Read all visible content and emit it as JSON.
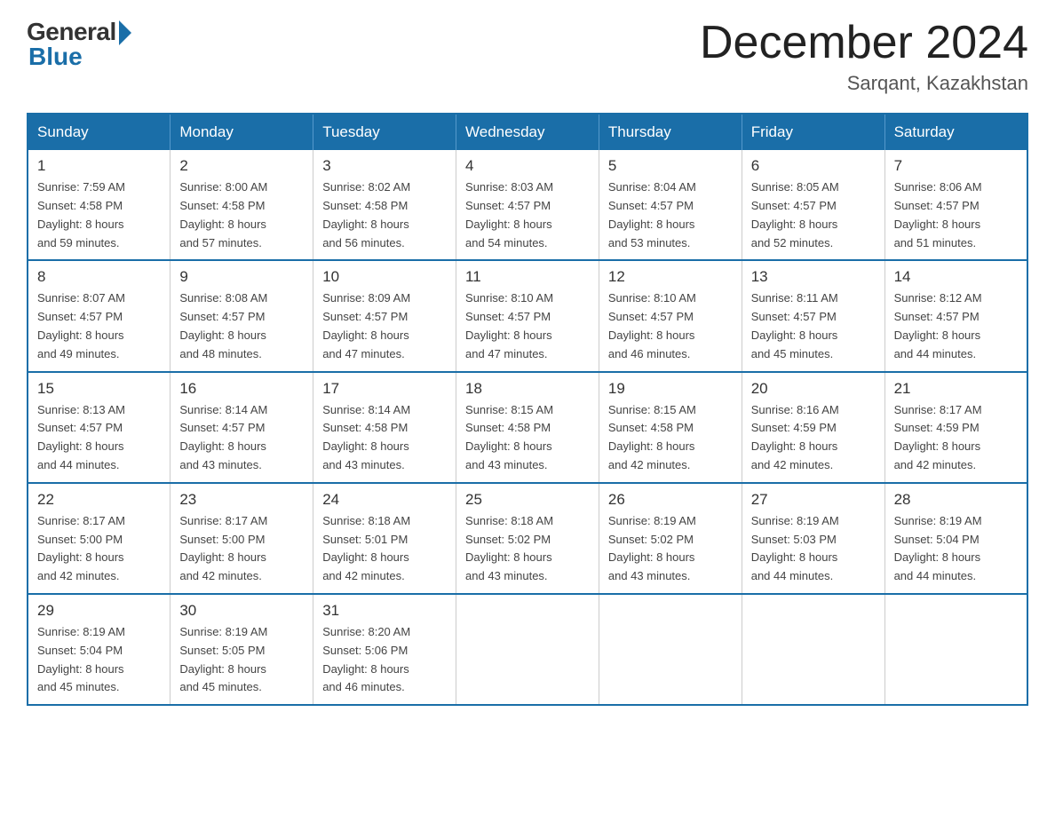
{
  "header": {
    "logo_general": "General",
    "logo_blue": "Blue",
    "month_title": "December 2024",
    "location": "Sarqant, Kazakhstan"
  },
  "weekdays": [
    "Sunday",
    "Monday",
    "Tuesday",
    "Wednesday",
    "Thursday",
    "Friday",
    "Saturday"
  ],
  "weeks": [
    [
      {
        "day": "1",
        "sunrise": "7:59 AM",
        "sunset": "4:58 PM",
        "daylight": "8 hours and 59 minutes."
      },
      {
        "day": "2",
        "sunrise": "8:00 AM",
        "sunset": "4:58 PM",
        "daylight": "8 hours and 57 minutes."
      },
      {
        "day": "3",
        "sunrise": "8:02 AM",
        "sunset": "4:58 PM",
        "daylight": "8 hours and 56 minutes."
      },
      {
        "day": "4",
        "sunrise": "8:03 AM",
        "sunset": "4:57 PM",
        "daylight": "8 hours and 54 minutes."
      },
      {
        "day": "5",
        "sunrise": "8:04 AM",
        "sunset": "4:57 PM",
        "daylight": "8 hours and 53 minutes."
      },
      {
        "day": "6",
        "sunrise": "8:05 AM",
        "sunset": "4:57 PM",
        "daylight": "8 hours and 52 minutes."
      },
      {
        "day": "7",
        "sunrise": "8:06 AM",
        "sunset": "4:57 PM",
        "daylight": "8 hours and 51 minutes."
      }
    ],
    [
      {
        "day": "8",
        "sunrise": "8:07 AM",
        "sunset": "4:57 PM",
        "daylight": "8 hours and 49 minutes."
      },
      {
        "day": "9",
        "sunrise": "8:08 AM",
        "sunset": "4:57 PM",
        "daylight": "8 hours and 48 minutes."
      },
      {
        "day": "10",
        "sunrise": "8:09 AM",
        "sunset": "4:57 PM",
        "daylight": "8 hours and 47 minutes."
      },
      {
        "day": "11",
        "sunrise": "8:10 AM",
        "sunset": "4:57 PM",
        "daylight": "8 hours and 47 minutes."
      },
      {
        "day": "12",
        "sunrise": "8:10 AM",
        "sunset": "4:57 PM",
        "daylight": "8 hours and 46 minutes."
      },
      {
        "day": "13",
        "sunrise": "8:11 AM",
        "sunset": "4:57 PM",
        "daylight": "8 hours and 45 minutes."
      },
      {
        "day": "14",
        "sunrise": "8:12 AM",
        "sunset": "4:57 PM",
        "daylight": "8 hours and 44 minutes."
      }
    ],
    [
      {
        "day": "15",
        "sunrise": "8:13 AM",
        "sunset": "4:57 PM",
        "daylight": "8 hours and 44 minutes."
      },
      {
        "day": "16",
        "sunrise": "8:14 AM",
        "sunset": "4:57 PM",
        "daylight": "8 hours and 43 minutes."
      },
      {
        "day": "17",
        "sunrise": "8:14 AM",
        "sunset": "4:58 PM",
        "daylight": "8 hours and 43 minutes."
      },
      {
        "day": "18",
        "sunrise": "8:15 AM",
        "sunset": "4:58 PM",
        "daylight": "8 hours and 43 minutes."
      },
      {
        "day": "19",
        "sunrise": "8:15 AM",
        "sunset": "4:58 PM",
        "daylight": "8 hours and 42 minutes."
      },
      {
        "day": "20",
        "sunrise": "8:16 AM",
        "sunset": "4:59 PM",
        "daylight": "8 hours and 42 minutes."
      },
      {
        "day": "21",
        "sunrise": "8:17 AM",
        "sunset": "4:59 PM",
        "daylight": "8 hours and 42 minutes."
      }
    ],
    [
      {
        "day": "22",
        "sunrise": "8:17 AM",
        "sunset": "5:00 PM",
        "daylight": "8 hours and 42 minutes."
      },
      {
        "day": "23",
        "sunrise": "8:17 AM",
        "sunset": "5:00 PM",
        "daylight": "8 hours and 42 minutes."
      },
      {
        "day": "24",
        "sunrise": "8:18 AM",
        "sunset": "5:01 PM",
        "daylight": "8 hours and 42 minutes."
      },
      {
        "day": "25",
        "sunrise": "8:18 AM",
        "sunset": "5:02 PM",
        "daylight": "8 hours and 43 minutes."
      },
      {
        "day": "26",
        "sunrise": "8:19 AM",
        "sunset": "5:02 PM",
        "daylight": "8 hours and 43 minutes."
      },
      {
        "day": "27",
        "sunrise": "8:19 AM",
        "sunset": "5:03 PM",
        "daylight": "8 hours and 44 minutes."
      },
      {
        "day": "28",
        "sunrise": "8:19 AM",
        "sunset": "5:04 PM",
        "daylight": "8 hours and 44 minutes."
      }
    ],
    [
      {
        "day": "29",
        "sunrise": "8:19 AM",
        "sunset": "5:04 PM",
        "daylight": "8 hours and 45 minutes."
      },
      {
        "day": "30",
        "sunrise": "8:19 AM",
        "sunset": "5:05 PM",
        "daylight": "8 hours and 45 minutes."
      },
      {
        "day": "31",
        "sunrise": "8:20 AM",
        "sunset": "5:06 PM",
        "daylight": "8 hours and 46 minutes."
      },
      null,
      null,
      null,
      null
    ]
  ],
  "labels": {
    "sunrise": "Sunrise:",
    "sunset": "Sunset:",
    "daylight": "Daylight:"
  }
}
